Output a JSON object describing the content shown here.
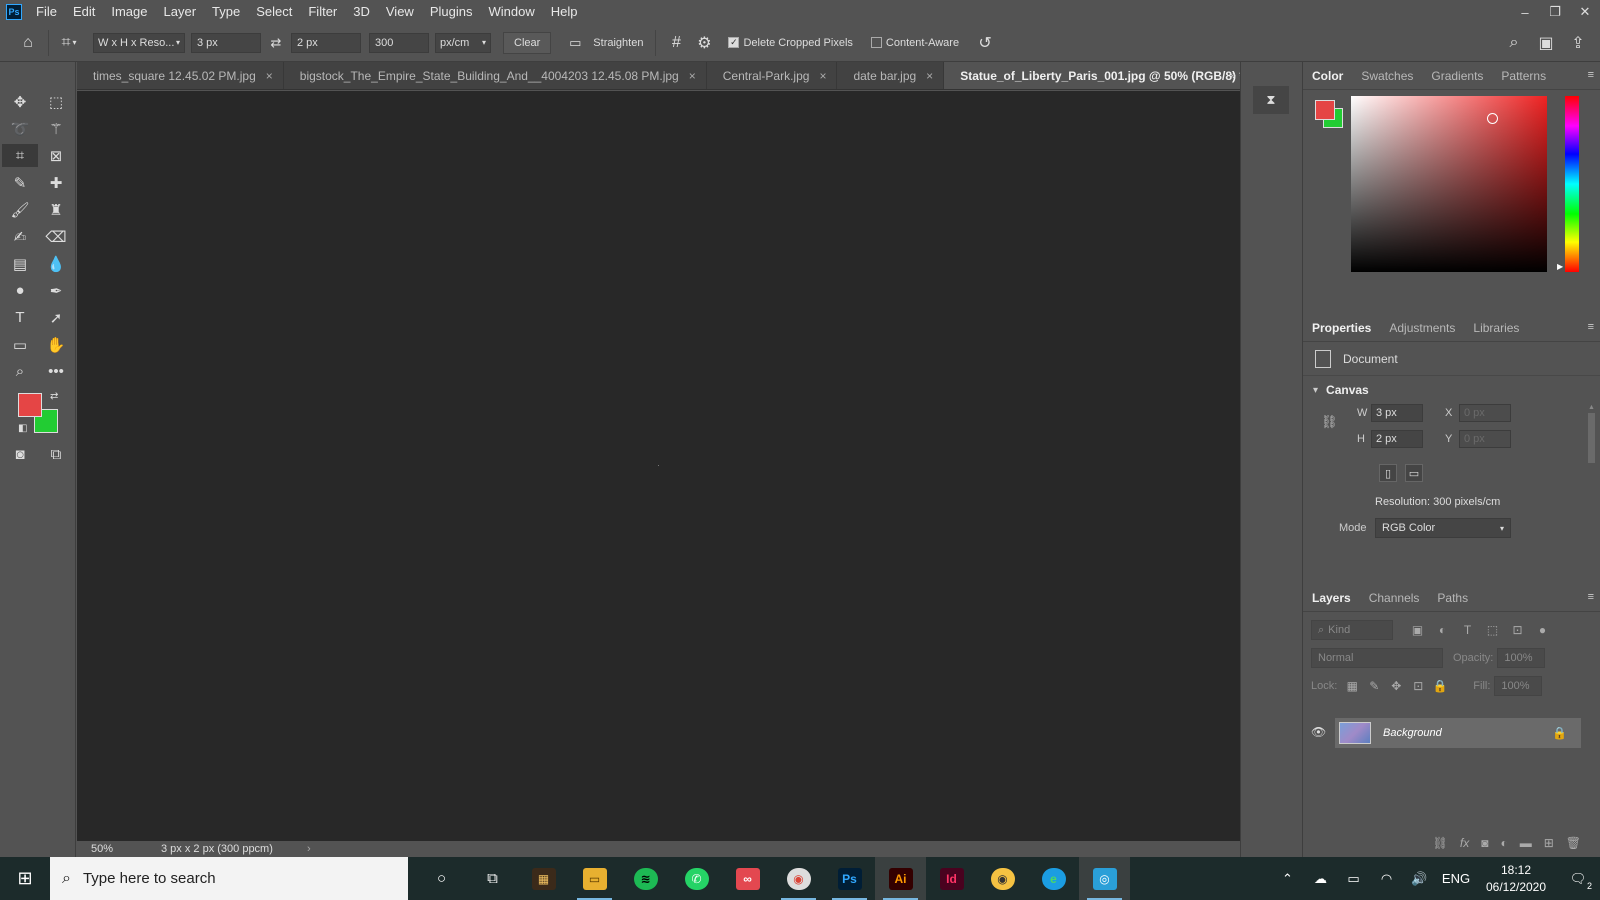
{
  "menu": {
    "logo": "Ps",
    "items": [
      "File",
      "Edit",
      "Image",
      "Layer",
      "Type",
      "Select",
      "Filter",
      "3D",
      "View",
      "Plugins",
      "Window",
      "Help"
    ]
  },
  "window_controls": {
    "minimize": "–",
    "restore": "❐",
    "close": "✕"
  },
  "options": {
    "ratio_select": "W x H x Reso...",
    "width_value": "3 px",
    "height_value": "2 px",
    "resolution_value": "300",
    "unit_select": "px/cm",
    "clear_label": "Clear",
    "straighten_label": "Straighten",
    "delete_cropped_label": "Delete Cropped Pixels",
    "delete_cropped_checked": true,
    "content_aware_label": "Content-Aware",
    "content_aware_checked": false
  },
  "tabs": [
    {
      "label": "times_square 12.45.02 PM.jpg",
      "active": false
    },
    {
      "label": "bigstock_The_Empire_State_Building_And__4004203 12.45.08 PM.jpg",
      "active": false
    },
    {
      "label": "Central-Park.jpg",
      "active": false
    },
    {
      "label": "date bar.jpg",
      "active": false
    },
    {
      "label": "Statue_of_Liberty_Paris_001.jpg @ 50% (RGB/8) *",
      "active": true
    }
  ],
  "status": {
    "zoom": "50%",
    "doc_info": "3 px x 2 px (300 ppcm)"
  },
  "colors": {
    "foreground": "#e54545",
    "background": "#22cc33"
  },
  "color_panel": {
    "tabs": [
      "Color",
      "Swatches",
      "Gradients",
      "Patterns"
    ],
    "active_tab": "Color"
  },
  "properties_panel": {
    "tabs": [
      "Properties",
      "Adjustments",
      "Libraries"
    ],
    "active_tab": "Properties",
    "document_label": "Document",
    "canvas_heading": "Canvas",
    "w_label": "W",
    "w_value": "3 px",
    "h_label": "H",
    "h_value": "2 px",
    "x_label": "X",
    "x_value": "0 px",
    "y_label": "Y",
    "y_value": "0 px",
    "resolution": "Resolution: 300 pixels/cm",
    "mode_label": "Mode",
    "mode_value": "RGB Color"
  },
  "layers_panel": {
    "tabs": [
      "Layers",
      "Channels",
      "Paths"
    ],
    "active_tab": "Layers",
    "kind_placeholder": "Kind",
    "blend_mode": "Normal",
    "opacity_label": "Opacity:",
    "opacity_value": "100%",
    "lock_label": "Lock:",
    "fill_label": "Fill:",
    "fill_value": "100%",
    "layer_name": "Background"
  },
  "taskbar": {
    "search_placeholder": "Type here to search",
    "language": "ENG",
    "time": "18:12",
    "date": "06/12/2020",
    "notification_count": "2"
  }
}
